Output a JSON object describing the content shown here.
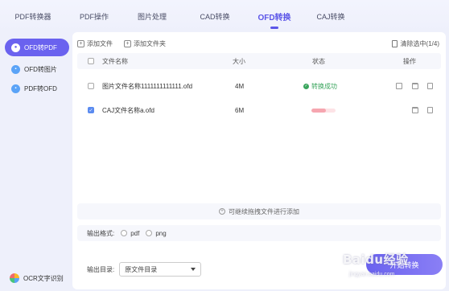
{
  "tabs": [
    {
      "label": "PDF转换器"
    },
    {
      "label": "PDF操作"
    },
    {
      "label": "图片处理"
    },
    {
      "label": "CAD转换"
    },
    {
      "label": "OFD转换",
      "active": true
    },
    {
      "label": "CAJ转换"
    }
  ],
  "sidebar": {
    "items": [
      {
        "label": "OFD转PDF",
        "active": true
      },
      {
        "label": "OFD转图片"
      },
      {
        "label": "PDF转OFD"
      }
    ],
    "ocr_label": "OCR文字识别"
  },
  "toolbar": {
    "add_file": "添加文件",
    "add_folder": "添加文件夹",
    "clear_selected": "清除选中(1/4)"
  },
  "table": {
    "headers": {
      "name": "文件名称",
      "size": "大小",
      "status": "状态",
      "action": "操作"
    },
    "rows": [
      {
        "name": "图片文件名称1111111111111.ofd",
        "size": "4M",
        "status": "转换成功",
        "checked": false
      },
      {
        "name": "CAJ文件名称a.ofd",
        "size": "6M",
        "status": "",
        "checked": true,
        "progress": 0.6
      }
    ]
  },
  "drop_hint": "可继续拖拽文件进行添加",
  "output": {
    "format_label": "输出格式:",
    "formats": [
      "pdf",
      "png"
    ],
    "dir_label": "输出目录:",
    "dir_value": "原文件目录"
  },
  "convert_button": "开始转换",
  "watermark": {
    "main": "Baidu经验",
    "sub": "jingyan.baidu.com"
  }
}
